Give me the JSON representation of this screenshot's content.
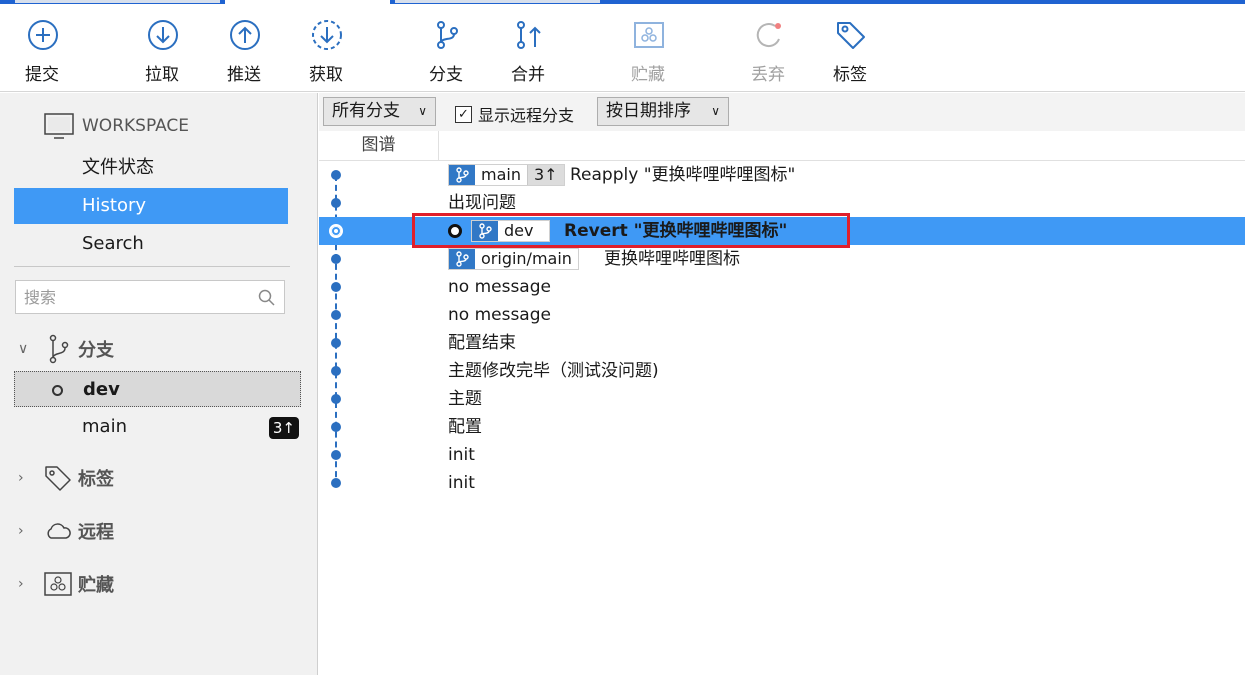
{
  "toolbar": {
    "commit": "提交",
    "pull": "拉取",
    "push": "推送",
    "fetch": "获取",
    "branch": "分支",
    "merge": "合并",
    "stash": "贮藏",
    "discard": "丢弃",
    "tag": "标签"
  },
  "sidebar": {
    "workspace_title": "WORKSPACE",
    "items": [
      {
        "label": "文件状态"
      },
      {
        "label": "History",
        "active": true
      },
      {
        "label": "Search"
      }
    ],
    "search_placeholder": "搜索",
    "branches_section": "分支",
    "branches": [
      {
        "name": "dev",
        "current": true
      },
      {
        "name": "main",
        "ahead": "3↑"
      }
    ],
    "tags_section": "标签",
    "remotes_section": "远程",
    "stashes_section": "贮藏"
  },
  "filter": {
    "branch_filter": "所有分支",
    "show_remote_label": "显示远程分支",
    "show_remote_checked": true,
    "sort": "按日期排序"
  },
  "columns": {
    "graph": "图谱"
  },
  "commits": [
    {
      "message": "Reapply \"更换哔哩哔哩图标\"",
      "refs": [
        {
          "name": "main",
          "ahead": "3↑"
        }
      ]
    },
    {
      "message": "出现问题"
    },
    {
      "message": "Revert \"更换哔哩哔哩图标\"",
      "refs": [
        {
          "name": "dev"
        }
      ],
      "selected": true,
      "head": true
    },
    {
      "message": "更换哔哩哔哩图标",
      "refs": [
        {
          "name": "origin/main"
        }
      ]
    },
    {
      "message": "no message"
    },
    {
      "message": "no message"
    },
    {
      "message": "配置结束"
    },
    {
      "message": "主题修改完毕（测试没问题)"
    },
    {
      "message": "主题"
    },
    {
      "message": "配置"
    },
    {
      "message": "init"
    },
    {
      "message": "init"
    }
  ],
  "colors": {
    "accent": "#3f99f5",
    "graph": "#2b6fc0",
    "highlight_box": "#e01f2b"
  }
}
